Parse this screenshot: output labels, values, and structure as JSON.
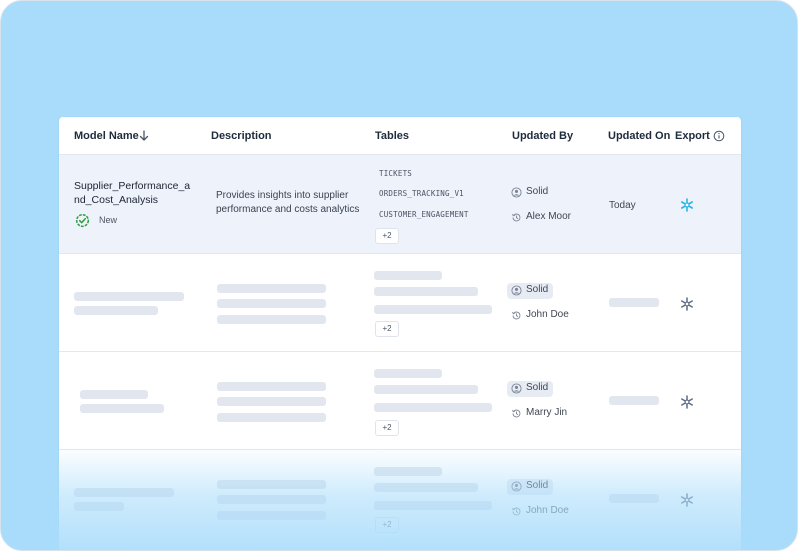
{
  "columns": {
    "model_name": "Model Name",
    "description": "Description",
    "tables": "Tables",
    "updated_by": "Updated By",
    "updated_on": "Updated On",
    "export": "Export"
  },
  "icons": {
    "sort": "arrow-down-icon",
    "info": "info-icon",
    "status_new": "check-badge-icon",
    "user": "user-circle-icon",
    "history": "history-icon",
    "export": "snowflake-icon"
  },
  "colors": {
    "page_background": "#a9dcfb",
    "active_row": "#eef2fa",
    "status_green": "#2e9e3e",
    "snowflake_active": "#29b5e8",
    "snowflake_muted": "#5d6b83"
  },
  "rows": [
    {
      "model_name": "Supplier_Performance_and_Cost_Analysis",
      "status": "New",
      "description": "Provides insights into supplier performance and costs analytics",
      "tables": [
        "TICKETS",
        "ORDERS_TRACKING_V1",
        "CUSTOMER_ENGAGEMENT"
      ],
      "more_tables": "+2",
      "owner": "Solid",
      "updater": "Alex Moor",
      "updated_on": "Today"
    },
    {
      "more_tables": "+2",
      "owner": "Solid",
      "updater": "John Doe"
    },
    {
      "more_tables": "+2",
      "owner": "Solid",
      "updater": "Marry Jin"
    },
    {
      "more_tables": "+2",
      "owner": "Solid",
      "updater": "John Doe"
    }
  ]
}
